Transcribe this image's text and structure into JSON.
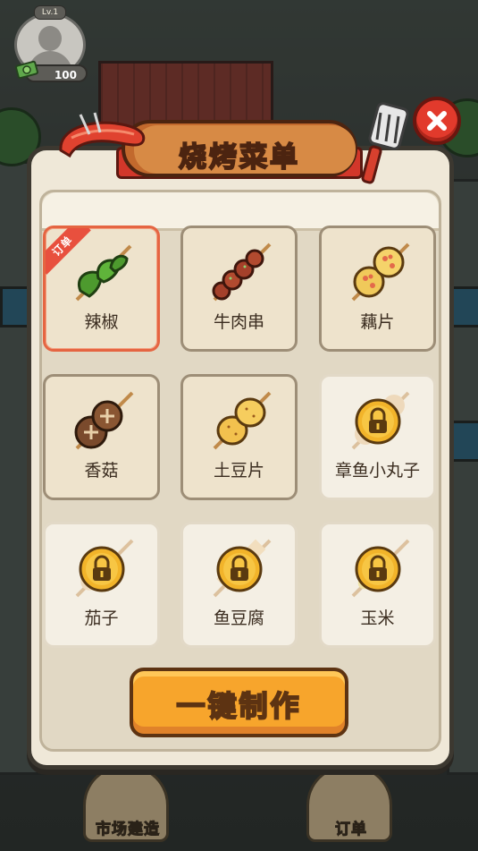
{
  "profile": {
    "level_label": "Lv.1",
    "coins": "100"
  },
  "menu": {
    "title": "烧烤菜单",
    "order_tag": "订单",
    "items": [
      {
        "name": "辣椒",
        "state": "unlocked",
        "selected": true,
        "has_order": true
      },
      {
        "name": "牛肉串",
        "state": "unlocked"
      },
      {
        "name": "藕片",
        "state": "unlocked"
      },
      {
        "name": "香菇",
        "state": "unlocked"
      },
      {
        "name": "土豆片",
        "state": "unlocked"
      },
      {
        "name": "章鱼小丸子",
        "state": "locked"
      },
      {
        "name": "茄子",
        "state": "locked"
      },
      {
        "name": "鱼豆腐",
        "state": "locked"
      },
      {
        "name": "玉米",
        "state": "locked"
      }
    ],
    "cook_button_label": "一键制作"
  },
  "bottom_nav": {
    "market_label": "市场建造",
    "orders_label": "订单"
  },
  "colors": {
    "accent_red": "#e23a2c",
    "button_orange": "#f7a52c",
    "panel_bg": "#efe8d8",
    "selected_border": "#e56542"
  }
}
